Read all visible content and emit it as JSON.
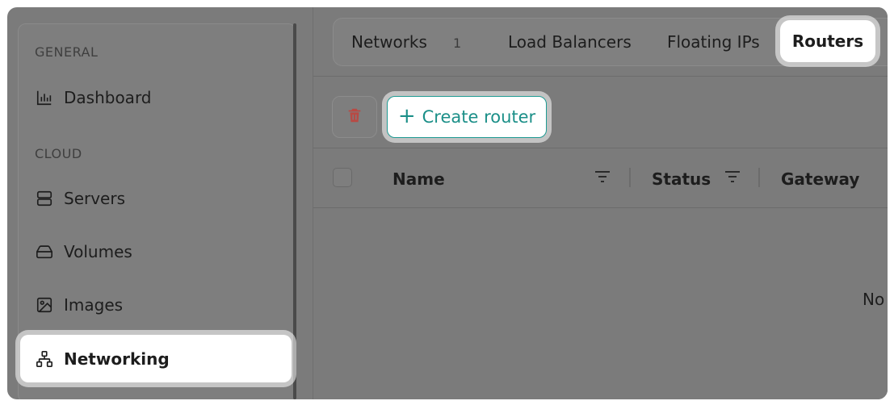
{
  "sidebar": {
    "sections": [
      {
        "label": "GENERAL"
      },
      {
        "label": "CLOUD"
      }
    ],
    "items": [
      {
        "label": "Dashboard",
        "icon": "bar-chart-icon"
      },
      {
        "label": "Servers",
        "icon": "server-icon"
      },
      {
        "label": "Volumes",
        "icon": "hard-drive-icon"
      },
      {
        "label": "Images",
        "icon": "image-icon"
      },
      {
        "label": "Networking",
        "icon": "network-icon",
        "active": true
      }
    ]
  },
  "tabs": [
    {
      "label": "Networks",
      "count": "1"
    },
    {
      "label": "Load Balancers"
    },
    {
      "label": "Floating IPs"
    },
    {
      "label": "Routers",
      "active": true
    }
  ],
  "toolbar": {
    "create_label": "Create router",
    "create_icon": "plus-icon",
    "delete_icon": "trash-icon"
  },
  "table": {
    "columns": [
      "Name",
      "Status",
      "Gateway"
    ],
    "empty_text": "No"
  },
  "colors": {
    "accent": "#1b8f88",
    "danger": "#b84a44"
  }
}
